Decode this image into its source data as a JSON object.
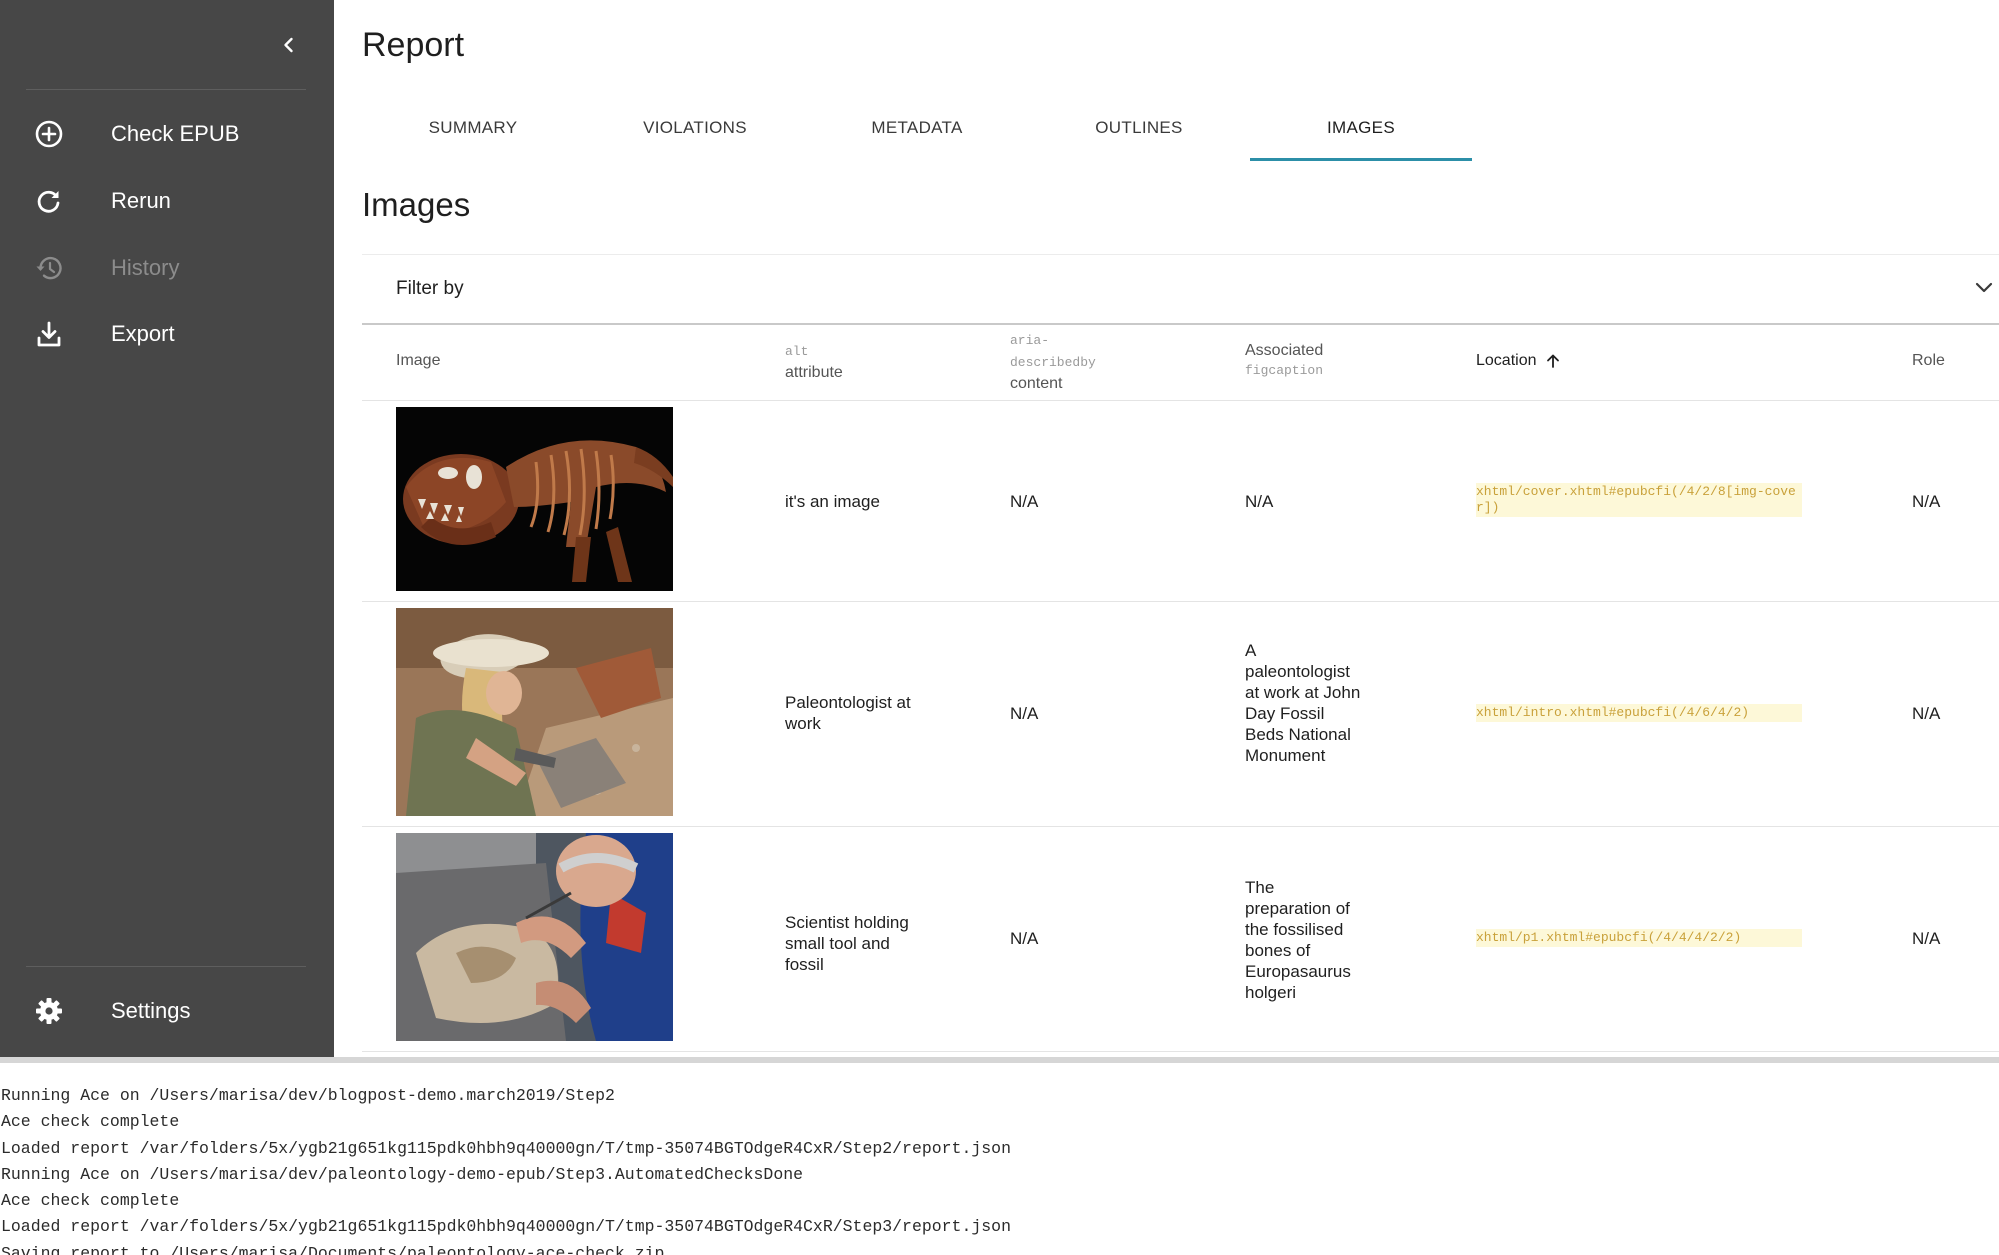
{
  "sidebar": {
    "items": [
      {
        "label": "Check EPUB",
        "icon": "plus-circle-icon"
      },
      {
        "label": "Rerun",
        "icon": "refresh-icon"
      },
      {
        "label": "History",
        "icon": "history-icon",
        "disabled": true
      },
      {
        "label": "Export",
        "icon": "download-icon"
      }
    ],
    "settings_label": "Settings"
  },
  "page_title": "Report",
  "tabs": [
    {
      "label": "SUMMARY"
    },
    {
      "label": "VIOLATIONS"
    },
    {
      "label": "METADATA"
    },
    {
      "label": "OUTLINES"
    },
    {
      "label": "IMAGES",
      "active": true
    }
  ],
  "section_title": "Images",
  "filter": {
    "label": "Filter by"
  },
  "table": {
    "headers": {
      "image": "Image",
      "alt_code": "alt",
      "alt_text": "attribute",
      "aria_code": "aria-describedby",
      "aria_text": "content",
      "fig_text": "Associated",
      "fig_code": "figcaption",
      "location": "Location",
      "role": "Role"
    },
    "rows": [
      {
        "thumb": "t-rex-skeleton",
        "alt": "it's an image",
        "describedby": "N/A",
        "figcaption": "N/A",
        "location": "xhtml/cover.xhtml#epubcfi(/4/2/8[img-cover])",
        "role": "N/A"
      },
      {
        "thumb": "paleontologist-digging",
        "alt": "Paleontologist at work",
        "describedby": "N/A",
        "figcaption": "A paleontologist at work at John Day Fossil Beds National Monument",
        "location": "xhtml/intro.xhtml#epubcfi(/4/6/4/2)",
        "role": "N/A"
      },
      {
        "thumb": "scientist-with-fossil",
        "alt": "Scientist holding small tool and fossil",
        "describedby": "N/A",
        "figcaption": "The preparation of the fossilised bones of Europasaurus holgeri",
        "location": "xhtml/p1.xhtml#epubcfi(/4/4/4/2/2)",
        "role": "N/A"
      }
    ]
  },
  "console": {
    "lines": [
      "Running Ace on /Users/marisa/dev/blogpost-demo.march2019/Step2",
      "Ace check complete",
      "Loaded report /var/folders/5x/ygb21g651kg115pdk0hbh9q40000gn/T/tmp-35074BGTOdgeR4CxR/Step2/report.json",
      "Running Ace on /Users/marisa/dev/paleontology-demo-epub/Step3.AutomatedChecksDone",
      "Ace check complete",
      "Loaded report /var/folders/5x/ygb21g651kg115pdk0hbh9q40000gn/T/tmp-35074BGTOdgeR4CxR/Step3/report.json",
      "Saving report to /Users/marisa/Documents/paleontology-ace-check.zip"
    ]
  },
  "colors": {
    "sidebar_bg": "#474747",
    "tab_underline": "#2c8fa8",
    "location_text": "#c9a13a",
    "location_bg": "#fdf8d8"
  }
}
